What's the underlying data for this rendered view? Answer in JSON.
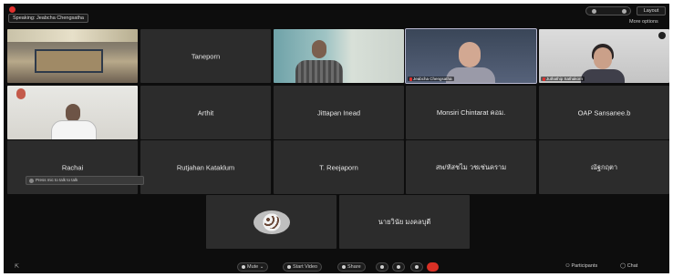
{
  "topbar": {
    "speaking": "Speaking: Jeabcha Chengsatha",
    "layout_label": "Layout",
    "more_options": "More options"
  },
  "tiles": [
    {
      "kind": "video",
      "scene": "room",
      "name": "",
      "label": ""
    },
    {
      "kind": "name",
      "name": "Taneporn"
    },
    {
      "kind": "video",
      "scene": "man",
      "name": "",
      "label": ""
    },
    {
      "kind": "video",
      "scene": "woman",
      "name": "",
      "label": "Jeabcha Chengsatha",
      "active": true
    },
    {
      "kind": "video",
      "scene": "girl",
      "name": "",
      "label": "Juthathip Sathakorn"
    },
    {
      "kind": "video",
      "scene": "office",
      "name": "",
      "label": ""
    },
    {
      "kind": "name",
      "name": "Arthit"
    },
    {
      "kind": "name",
      "name": "Jittapan Inead"
    },
    {
      "kind": "name",
      "name": "Monsiri Chintarat คอม."
    },
    {
      "kind": "name",
      "name": "OAP Sansanee.b"
    },
    {
      "kind": "name",
      "name": "Rachai"
    },
    {
      "kind": "name",
      "name": "Rutjahan Kataklum"
    },
    {
      "kind": "name",
      "name": "T. Reejaporn"
    },
    {
      "kind": "name",
      "name": "สพ/หัสชไม วชเช่นคราม"
    },
    {
      "kind": "name",
      "name": "ณัฐกฤตา"
    },
    {
      "kind": "avatar",
      "name": ""
    },
    {
      "kind": "name",
      "name": "นายวินัย มงคลบุตี"
    }
  ],
  "self_chip": "Press mic to talk to talk",
  "bottombar": {
    "mute": "Mute",
    "video": "Start Video",
    "share": "Share",
    "participants": "Participants",
    "chat": "Chat"
  }
}
